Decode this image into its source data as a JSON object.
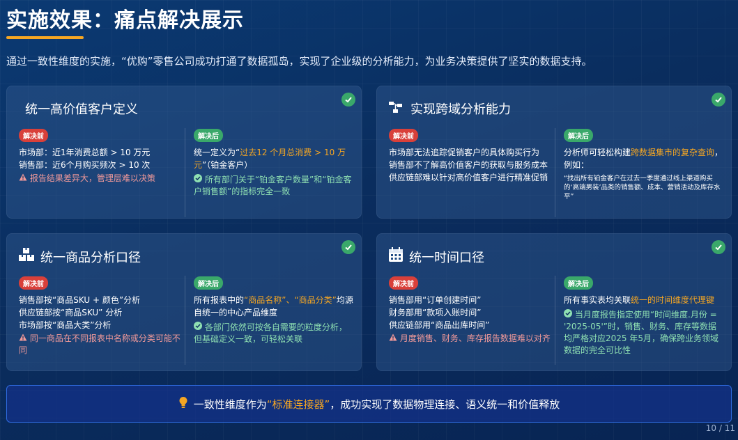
{
  "page": {
    "title": "实施效果：痛点解决展示",
    "intro": "通过一致性维度的实施，“优购”零售公司成功打通了数据孤岛，实现了企业级的分析能力，为业务决策提供了坚实的数据支持。",
    "page_number": "10 / 11"
  },
  "labels": {
    "before": "解决前",
    "after": "解决后"
  },
  "cards": {
    "customer": {
      "title": "统一高价值客户定义",
      "before_lines": [
        "市场部：近1年消费总额 > 10 万元",
        "销售部：近6个月购买频次 > 10 次"
      ],
      "before_warn": "报告结果差异大，管理层难以决策",
      "after_pre": "统一定义为“",
      "after_hl": "过去12 个月总消费 > 10 万元",
      "after_post": "”（铂金客户）",
      "after_ok": "所有部门关于“铂金客户数量”和“铂金客户销售额”的指标完全一致"
    },
    "crossdomain": {
      "title": "实现跨域分析能力",
      "before_lines": [
        "市场部无法追踪促销客户的具体购买行为",
        "销售部不了解高价值客户的获取与服务成本",
        "供应链部难以针对高价值客户进行精准促销"
      ],
      "after_pre": "分析师可轻松构建",
      "after_hl": "跨数据集市的复杂查询",
      "after_post": "，例如：",
      "after_example": "“找出所有铂金客户在过去一季度通过线上渠道购买的‘高端男装’品类的销售额、成本、营销活动及库存水平”"
    },
    "product": {
      "title": "统一商品分析口径",
      "before_lines": [
        "销售部按“商品SKU + 颜色”分析",
        "供应链部按“商品SKU” 分析",
        "市场部按“商品大类”分析"
      ],
      "before_warn": "同一商品在不同报表中名称或分类可能不同",
      "after_pre": "所有报表中的",
      "after_hl": "“商品名称”、“商品分类”",
      "after_post": "均源自统一的中心产品维度",
      "after_ok": "各部门依然可按各自需要的粒度分析，但基础定义一致，可轻松关联"
    },
    "time": {
      "title": "统一时间口径",
      "before_lines": [
        "销售部用“订单创建时间”",
        "财务部用“款项入账时间”",
        "供应链部用“商品出库时间”"
      ],
      "before_warn": "月度销售、财务、库存报告数据难以对齐",
      "after_pre": "所有事实表均关联",
      "after_hl": "统一的时间维度代理键",
      "after_post": "",
      "after_ok": "当月度报告指定使用“时间维度.月份 = '2025-05'”时，销售、财务、库存等数据均严格对应2025 年5月，确保跨业务领域数据的完全可比性"
    }
  },
  "footer": {
    "pre": "一致性维度作为",
    "hl": "“标准连接器”",
    "post": "，成功实现了数据物理连接、语义统一和价值释放"
  },
  "colors": {
    "accent": "#f5a623",
    "before": "#d9403a",
    "after": "#3aa86a",
    "background": "#0a2d5e"
  }
}
